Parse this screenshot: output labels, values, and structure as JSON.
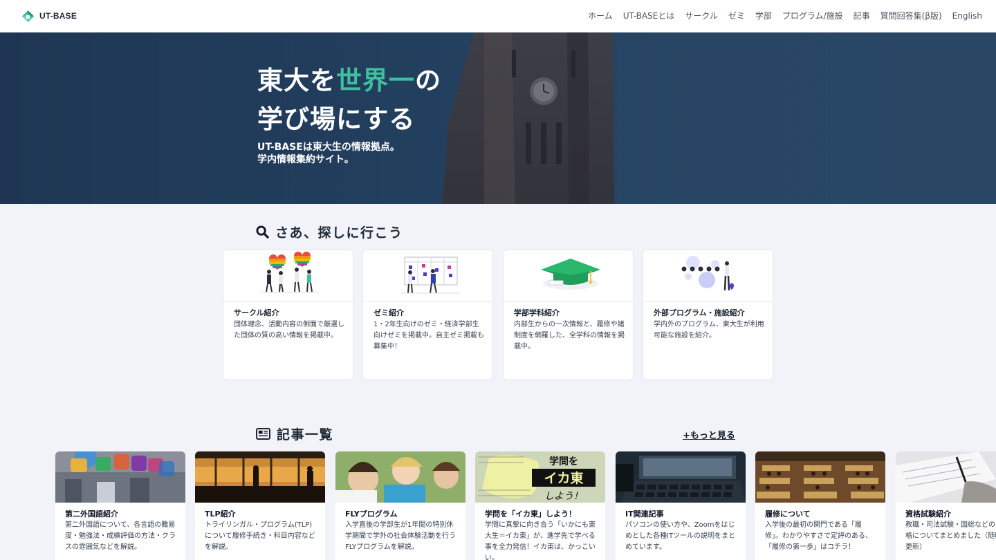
{
  "header": {
    "logo_text": "UT-BASE",
    "nav": [
      {
        "label": "ホーム"
      },
      {
        "label": "UT-BASEとは"
      },
      {
        "label": "サークル"
      },
      {
        "label": "ゼミ"
      },
      {
        "label": "学部"
      },
      {
        "label": "プログラム/施設"
      },
      {
        "label": "記事"
      },
      {
        "label": "質問回答集(β版)"
      },
      {
        "label": "English"
      }
    ]
  },
  "hero": {
    "title_part1": "東大を",
    "title_accent": "世界一",
    "title_part2": "の",
    "title_line2": "学び場にする",
    "sub_line1": "UT-BASEは東大生の情報拠点。",
    "sub_line2": "学内情報集約サイト。",
    "accent_color": "#3ebfa0"
  },
  "search_section": {
    "heading": "さあ、探しに行こう",
    "icon": "search-icon",
    "cards": [
      {
        "title": "サークル紹介",
        "desc": "団体理念、活動内容の側面で厳選した団体の質の高い情報を掲載中。"
      },
      {
        "title": "ゼミ紹介",
        "desc": "1・2年生向けのゼミ・経済学部生向けゼミを掲載中。自主ゼミ掲載も募集中！"
      },
      {
        "title": "学部学科紹介",
        "desc": "内部生からの一次情報と、履修や諸制度を網羅した、全学科の情報を掲載中。"
      },
      {
        "title": "外部プログラム・施設紹介",
        "desc": "学内外のプログラム、東大生が利用可能な施設を紹介。"
      }
    ]
  },
  "articles_section": {
    "heading": "記事一覧",
    "icon": "newspaper-icon",
    "more_label": "+もっと見る",
    "articles": [
      {
        "title": "第二外国語紹介",
        "desc": "第二外国語について、各言語の難易度・勉強法・成績評価の方法・クラスの雰囲気などを解説。"
      },
      {
        "title": "TLP紹介",
        "desc": "トライリンガル・プログラム(TLP)について履修手続き・科目内容などを解説。"
      },
      {
        "title": "FLYプログラム",
        "desc": "入学直後の学部生が1年間の特別休学期間で学外の社会体験活動を行うFLYプログラムを解説。"
      },
      {
        "title": "学問を「イカ東」しよう！",
        "desc": "学問に真摯に向き合う「いかにも東大生＝イカ東」が、進学先で学べる事を全力発信！イカ東は、かっこいい。",
        "thumb_text_1": "学問を",
        "thumb_text_2": "イカ東",
        "thumb_text_3": "しよう！"
      },
      {
        "title": "IT関連記事",
        "desc": "パソコンの使い方や、Zoomをはじめとした各種ITツールの説明をまとめています。"
      },
      {
        "title": "履修について",
        "desc": "入学後の最初の関門である「履修」。わかりやすさで定評のある、「履修の第一歩」はコチラ！"
      },
      {
        "title": "資格試験紹介",
        "desc": "教職・司法試験・国総などの資格についてまとめました（随時更新）"
      }
    ]
  }
}
